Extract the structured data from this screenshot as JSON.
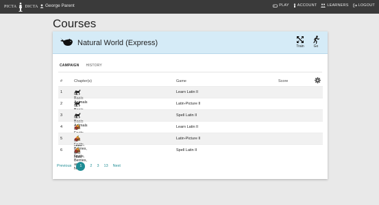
{
  "nav": {
    "brand_left": "PICTA",
    "brand_right": "DICTA",
    "user": "George Parent",
    "links": [
      {
        "label": "PLAY",
        "icon": "gamepad-icon"
      },
      {
        "label": "ACCOUNT",
        "icon": "user-icon"
      },
      {
        "label": "LEARNERS",
        "icon": "users-icon"
      },
      {
        "label": "LOGOUT",
        "icon": "logout-icon"
      }
    ]
  },
  "page": {
    "title": "Courses"
  },
  "course": {
    "name": "Natural World (Express)",
    "icon": "whale-icon",
    "actions": [
      {
        "label": "Train",
        "icon": "expand-arrows-icon"
      },
      {
        "label": "Go",
        "icon": "running-icon"
      }
    ]
  },
  "tabs": [
    {
      "label": "CAMPAIGN",
      "active": true
    },
    {
      "label": "HISTORY",
      "active": false
    }
  ],
  "table": {
    "headers": [
      "#",
      "Chapter(s)",
      "Game",
      "Score"
    ],
    "rows": [
      {
        "num": "1",
        "chapter": "01 - Basic Animals",
        "game": "Learn Latin II",
        "score": "",
        "icon": "horse-icon"
      },
      {
        "num": "2",
        "chapter": "01 - Basic Animals",
        "game": "Latin-Picture II",
        "score": "",
        "icon": "horse-icon"
      },
      {
        "num": "3",
        "chapter": "01 - Basic Animals",
        "game": "Spell Latin II",
        "score": "",
        "icon": "horse-icon"
      },
      {
        "num": "4",
        "chapter": "02 - Fruits, Berries, and Nuts",
        "game": "Learn Latin II",
        "score": "",
        "icon": "fruit-icon"
      },
      {
        "num": "5",
        "chapter": "02 - Fruits, Berries, and Nuts",
        "game": "Latin-Picture II",
        "score": "",
        "icon": "fruit-icon"
      },
      {
        "num": "6",
        "chapter": "02 - Fruits, Berries, and Nuts",
        "game": "Spell Latin II",
        "score": "",
        "icon": "fruit-icon"
      }
    ]
  },
  "pagination": {
    "previous": "Previous",
    "pages": [
      "1",
      "2",
      "3",
      "13"
    ],
    "current": "1",
    "next": "Next"
  },
  "colors": {
    "accent": "#1e8c94",
    "header_bg": "#d5ebf7",
    "topbar_bg": "#3a3a3a"
  }
}
